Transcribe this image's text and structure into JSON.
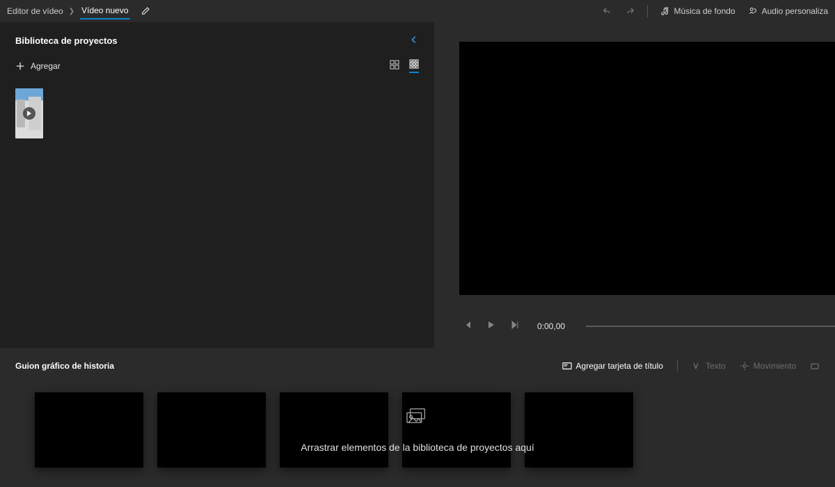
{
  "breadcrumb": {
    "root": "Editor de vídeo",
    "current": "Vídeo nuevo"
  },
  "topbar": {
    "background_music": "Música de fondo",
    "custom_audio": "Audio personaliza"
  },
  "library": {
    "title": "Biblioteca de proyectos",
    "add_label": "Agregar"
  },
  "player": {
    "timecode": "0:00,00"
  },
  "storyboard": {
    "title": "Guion gráfico de historia",
    "add_title_card": "Agregar tarjeta de título",
    "text": "Texto",
    "motion": "Movimiento",
    "drop_hint": "Arrastrar elementos de la biblioteca de proyectos aquí"
  }
}
